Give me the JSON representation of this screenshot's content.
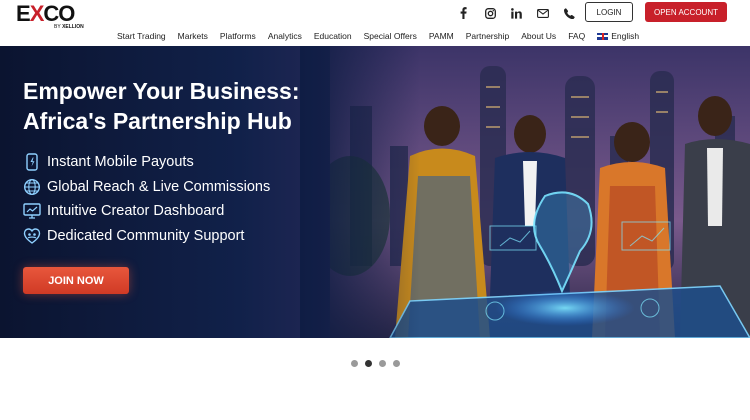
{
  "brand": {
    "logo_main": "EXCO",
    "logo_by": "BY",
    "logo_sub": "XELLION",
    "accent_color": "#c8202a"
  },
  "header": {
    "social": [
      {
        "icon": "facebook-icon"
      },
      {
        "icon": "instagram-icon"
      },
      {
        "icon": "linkedin-icon"
      },
      {
        "icon": "mail-icon"
      },
      {
        "icon": "phone-icon"
      }
    ],
    "login_label": "LOGIN",
    "open_account_label": "OPEN ACCOUNT"
  },
  "nav": {
    "items": [
      "Start Trading",
      "Markets",
      "Platforms",
      "Analytics",
      "Education",
      "Special Offers",
      "PAMM",
      "Partnership",
      "About Us",
      "FAQ"
    ],
    "language": "English",
    "language_flag_icon": "uk-flag-icon"
  },
  "hero": {
    "title_line1": "Empower Your Business:",
    "title_line2": "Africa's Partnership Hub",
    "features": [
      {
        "icon": "mobile-payout-icon",
        "text": "Instant Mobile Payouts"
      },
      {
        "icon": "globe-icon",
        "text": "Global Reach & Live Commissions"
      },
      {
        "icon": "dashboard-icon",
        "text": "Intuitive Creator Dashboard"
      },
      {
        "icon": "community-icon",
        "text": "Dedicated Community Support"
      }
    ],
    "cta_label": "JOIN NOW"
  },
  "carousel": {
    "slide_count": 4,
    "active_index": 1
  }
}
